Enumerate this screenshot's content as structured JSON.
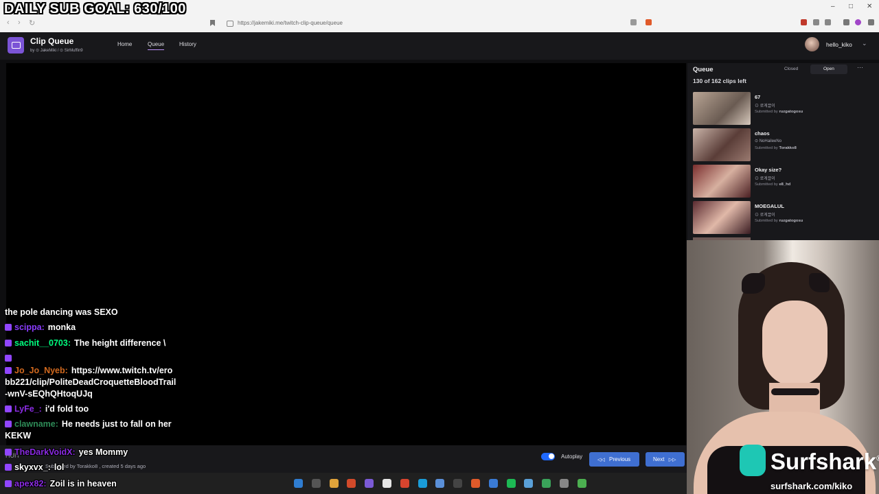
{
  "overlay": {
    "goal_text": "DAILY SUB GOAL: 630/100"
  },
  "browser": {
    "url": "https://jakemiki.me/twitch-clip-queue/queue",
    "back": "‹",
    "forward": "›",
    "reload": "↻",
    "win_min": "–",
    "win_max": "□",
    "win_close": "✕"
  },
  "app": {
    "title": "Clip Queue",
    "byline": "by ⊙ JakeMiki / ⊙ SirMuffin9",
    "nav": {
      "home": "Home",
      "queue": "Queue",
      "history": "History"
    },
    "user": {
      "name": "hello_kiko",
      "caret": "⌄"
    }
  },
  "player": {
    "autoplay_label": "Autoplay",
    "autoplay_on": true,
    "previous_label": "Previous",
    "previous_icon": "◁◁",
    "next_label": "Next",
    "next_icon": "▷▷",
    "submitted_text": "Submitted by Torakko8 , created 5 days ago",
    "partial_text": "HUH"
  },
  "queue": {
    "title": "Queue",
    "closed_label": "Closed",
    "open_label": "Open",
    "more_icon": "⋯",
    "count_text": "130 of 162 clips left",
    "clips": [
      {
        "title": "67",
        "channel": "⊙ 로게끌이",
        "submitted_prefix": "Submitted by ",
        "submitter": "ruzgatogosu"
      },
      {
        "title": "chaos",
        "channel": "⊙ NoHaileeNo",
        "submitted_prefix": "Submitted by ",
        "submitter": "Torakko8"
      },
      {
        "title": "Okay size?",
        "channel": "⊙ 로게끌이",
        "submitted_prefix": "Submitted by ",
        "submitter": "e8_hd"
      },
      {
        "title": "MOEGALUL",
        "channel": "⊙ 로게끌이",
        "submitted_prefix": "Submitted by ",
        "submitter": "ruzgatogosu"
      }
    ]
  },
  "chat": {
    "messages": [
      {
        "user": "",
        "color": "#ffffff",
        "text": "the pole dancing was SEXO"
      },
      {
        "user": "scippa",
        "color": "#8a3cff",
        "text": "monka"
      },
      {
        "user": "sachit__0703",
        "color": "#00ff7f",
        "text": "The height difference \\"
      },
      {
        "user": "",
        "color": "#ffffff",
        "text": ""
      },
      {
        "user": "Jo_Jo_Nyeb",
        "color": "#d2691e",
        "text": "https://www.twitch.tv/erobb221/clip/PoliteDeadCroquetteBloodTrail-wnV-sEQhQHtoqUJq"
      },
      {
        "user": "LyFe_",
        "color": "#8a2be2",
        "text": "i'd fold too"
      },
      {
        "user": "clawname",
        "color": "#2e8b57",
        "text": "He needs just to fall on her KEKW"
      },
      {
        "user": "TheDarkVoidX",
        "color": "#8a2be2",
        "text": "yes Mommy"
      },
      {
        "user": "skyxvx_",
        "color": "#ffffff",
        "text": "lol"
      },
      {
        "user": "apex82",
        "color": "#8a2be2",
        "text": "Zoil is in heaven"
      }
    ]
  },
  "sponsor": {
    "name": "Surfshark",
    "registered": "®",
    "url": "surfshark.com/kiko"
  },
  "colors": {
    "accent": "#9146ff",
    "button": "#3f6fd1",
    "bg": "#18181b"
  }
}
